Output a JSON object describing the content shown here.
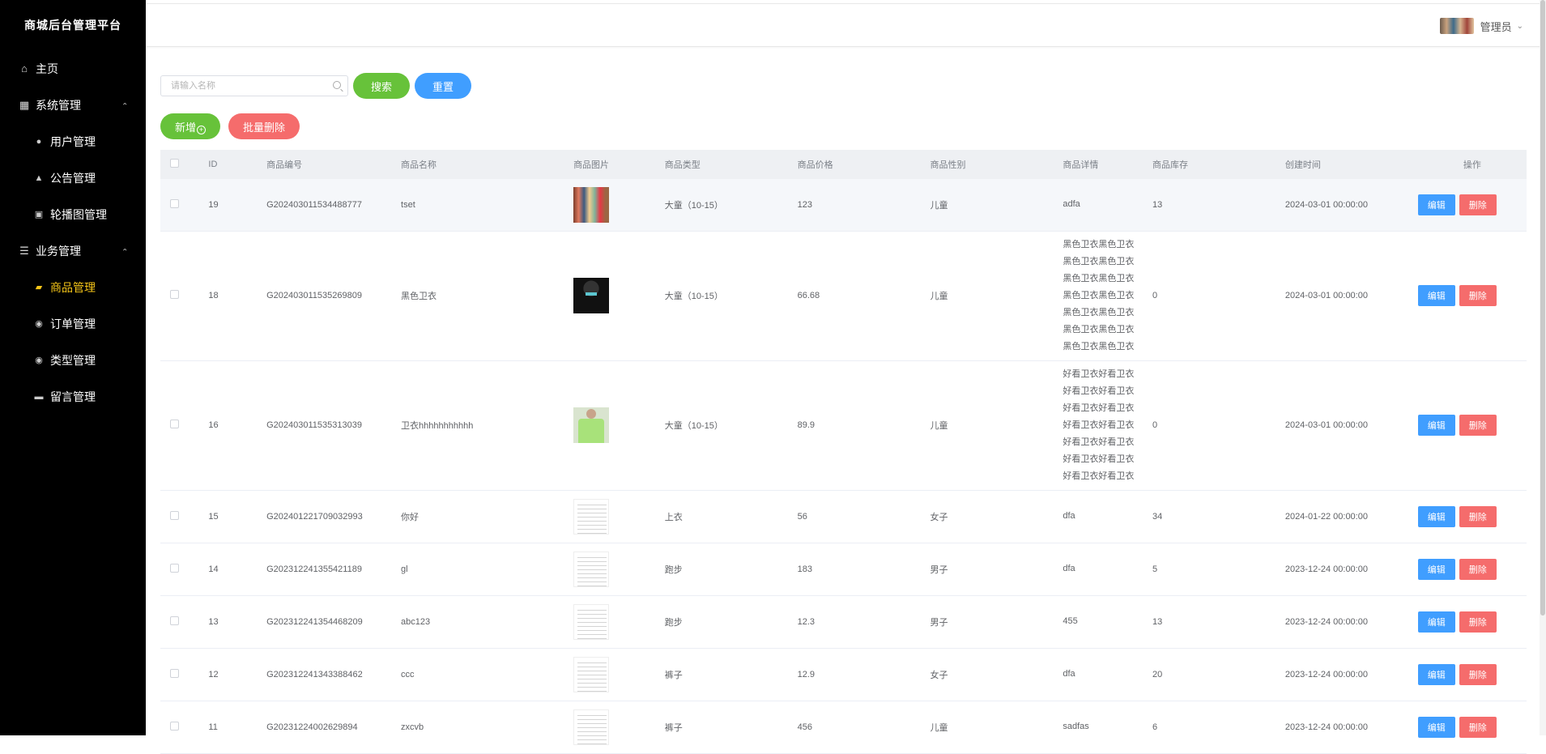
{
  "app": {
    "title": "商城后台管理平台"
  },
  "sidebar": {
    "items": [
      {
        "label": "主页",
        "icon": "home-icon",
        "level": 1
      },
      {
        "label": "系统管理",
        "icon": "grid-icon",
        "level": 1,
        "expanded": true
      },
      {
        "label": "用户管理",
        "icon": "user-icon",
        "level": 2
      },
      {
        "label": "公告管理",
        "icon": "bell-icon",
        "level": 2
      },
      {
        "label": "轮播图管理",
        "icon": "picture-icon",
        "level": 2
      },
      {
        "label": "业务管理",
        "icon": "sliders-icon",
        "level": 1,
        "expanded": true
      },
      {
        "label": "商品管理",
        "icon": "thumb-icon",
        "level": 2,
        "active": true
      },
      {
        "label": "订单管理",
        "icon": "location-icon",
        "level": 2
      },
      {
        "label": "类型管理",
        "icon": "location-icon",
        "level": 2
      },
      {
        "label": "留言管理",
        "icon": "chat-icon",
        "level": 2
      }
    ],
    "active_color": "#f5c518"
  },
  "header": {
    "user_name": "管理员"
  },
  "toolbar": {
    "search_placeholder": "请输入名称",
    "search_label": "搜索",
    "reset_label": "重置",
    "add_label": "新增",
    "batch_delete_label": "批量删除"
  },
  "table": {
    "columns": [
      "ID",
      "商品编号",
      "商品名称",
      "商品图片",
      "商品类型",
      "商品价格",
      "商品性别",
      "商品详情",
      "商品库存",
      "创建时间",
      "操作"
    ],
    "edit_label": "编辑",
    "delete_label": "删除",
    "rows": [
      {
        "id": "19",
        "code": "G202403011534488777",
        "name": "tset",
        "image": "colorful",
        "type": "大童（10-15）",
        "price": "123",
        "gender": "儿童",
        "detail": [
          "adfa"
        ],
        "stock": "13",
        "created": "2024-03-01 00:00:00"
      },
      {
        "id": "18",
        "code": "G202403011535269809",
        "name": "黑色卫衣",
        "image": "hoodie",
        "type": "大童（10-15）",
        "price": "66.68",
        "gender": "儿童",
        "detail": [
          "黑色卫衣黑色卫衣",
          "黑色卫衣黑色卫衣",
          "黑色卫衣黑色卫衣",
          "黑色卫衣黑色卫衣",
          "黑色卫衣黑色卫衣",
          "黑色卫衣黑色卫衣",
          "黑色卫衣黑色卫衣"
        ],
        "stock": "0",
        "created": "2024-03-01 00:00:00"
      },
      {
        "id": "16",
        "code": "G202403011535313039",
        "name": "卫衣hhhhhhhhhhh",
        "image": "green",
        "type": "大童（10-15）",
        "price": "89.9",
        "gender": "儿童",
        "detail": [
          "好看卫衣好看卫衣",
          "好看卫衣好看卫衣",
          "好看卫衣好看卫衣",
          "好看卫衣好看卫衣",
          "好看卫衣好看卫衣",
          "好看卫衣好看卫衣",
          "好看卫衣好看卫衣"
        ],
        "stock": "0",
        "created": "2024-03-01 00:00:00"
      },
      {
        "id": "15",
        "code": "G202401221709032993",
        "name": "你好",
        "image": "doc",
        "type": "上衣",
        "price": "56",
        "gender": "女子",
        "detail": [
          "dfa"
        ],
        "stock": "34",
        "created": "2024-01-22 00:00:00"
      },
      {
        "id": "14",
        "code": "G202312241355421189",
        "name": "gl",
        "image": "doc",
        "type": "跑步",
        "price": "183",
        "gender": "男子",
        "detail": [
          "dfa"
        ],
        "stock": "5",
        "created": "2023-12-24 00:00:00"
      },
      {
        "id": "13",
        "code": "G202312241354468209",
        "name": "abc123",
        "image": "doc",
        "type": "跑步",
        "price": "12.3",
        "gender": "男子",
        "detail": [
          "455"
        ],
        "stock": "13",
        "created": "2023-12-24 00:00:00"
      },
      {
        "id": "12",
        "code": "G202312241343388462",
        "name": "ccc",
        "image": "doc",
        "type": "裤子",
        "price": "12.9",
        "gender": "女子",
        "detail": [
          "dfa"
        ],
        "stock": "20",
        "created": "2023-12-24 00:00:00"
      },
      {
        "id": "11",
        "code": "G20231224002629894",
        "name": "zxcvb",
        "image": "doc",
        "type": "裤子",
        "price": "456",
        "gender": "儿童",
        "detail": [
          "sadfas"
        ],
        "stock": "6",
        "created": "2023-12-24 00:00:00"
      }
    ]
  }
}
